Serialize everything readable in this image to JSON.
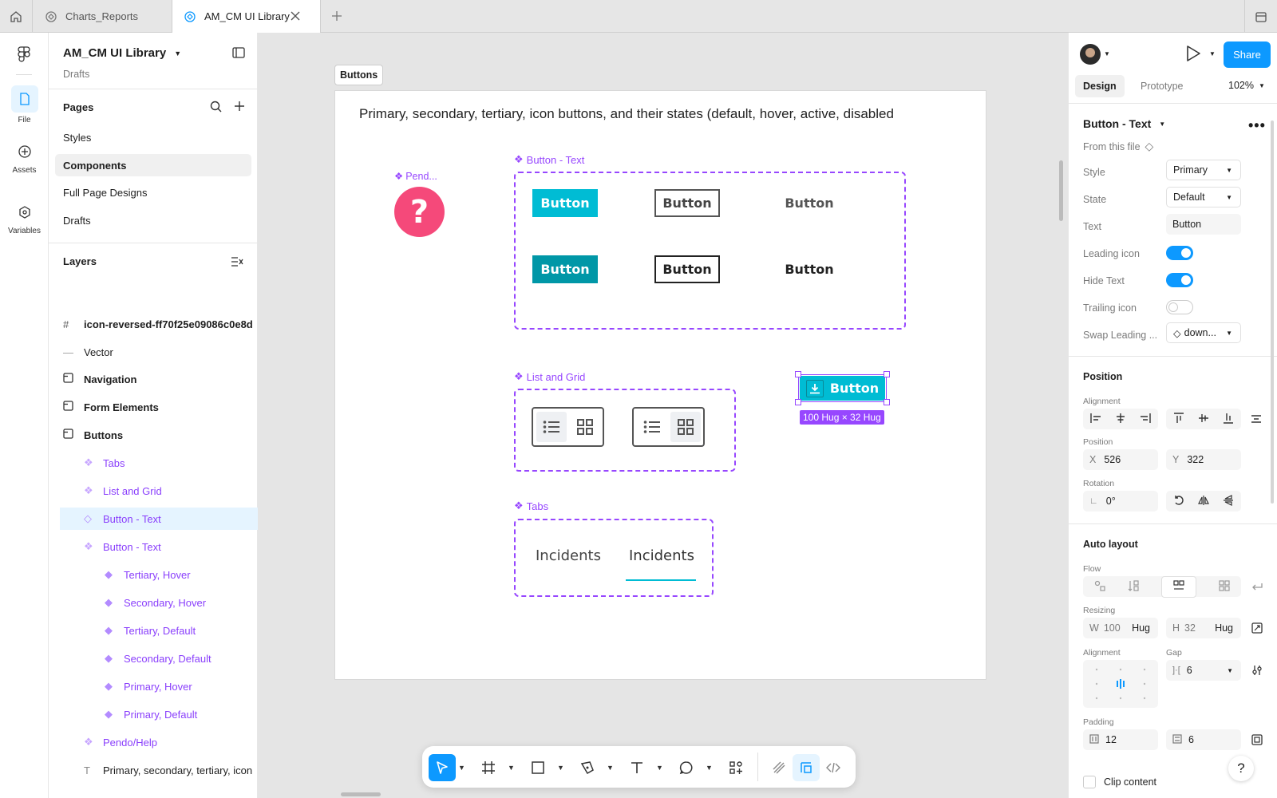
{
  "tabs": [
    {
      "label": "Charts_Reports"
    },
    {
      "label": "AM_CM UI Library"
    }
  ],
  "rail": {
    "file": "File",
    "assets": "Assets",
    "variables": "Variables"
  },
  "file": {
    "title": "AM_CM UI Library",
    "subtitle": "Drafts"
  },
  "pages": {
    "heading": "Pages",
    "items": [
      "Styles",
      "Components",
      "Full Page Designs",
      "Drafts"
    ]
  },
  "layers": {
    "heading": "Layers",
    "items": [
      {
        "label": "icon-reversed-ff70f25e09086c0e8d"
      },
      {
        "label": "Vector"
      },
      {
        "label": "Navigation"
      },
      {
        "label": "Form Elements"
      },
      {
        "label": "Buttons"
      },
      {
        "label": "Tabs"
      },
      {
        "label": "List and Grid"
      },
      {
        "label": "Button - Text"
      },
      {
        "label": "Button - Text"
      },
      {
        "label": "Tertiary, Hover"
      },
      {
        "label": "Secondary, Hover"
      },
      {
        "label": "Tertiary, Default"
      },
      {
        "label": "Secondary, Default"
      },
      {
        "label": "Primary, Hover"
      },
      {
        "label": "Primary, Default"
      },
      {
        "label": "Pendo/Help"
      },
      {
        "label": "Primary, secondary, tertiary, icon"
      }
    ]
  },
  "canvas": {
    "frame_label": "Buttons",
    "description": "Primary, secondary, tertiary, icon buttons, and their states (default, hover, active, disabled",
    "pendo_label": "Pend...",
    "pendo_glyph": "?",
    "button_text_label": "Button - Text",
    "button_label": "Button",
    "list_grid_label": "List and Grid",
    "tabs_label": "Tabs",
    "tab_items": [
      "Incidents",
      "Incidents"
    ],
    "selected_button_label": "Button",
    "size_badge": "100 Hug × 32 Hug"
  },
  "design": {
    "tabs": [
      "Design",
      "Prototype"
    ],
    "zoom": "102%",
    "share": "Share",
    "component_name": "Button - Text",
    "from_file": "From this file",
    "props": {
      "style_label": "Style",
      "style_value": "Primary",
      "state_label": "State",
      "state_value": "Default",
      "text_label": "Text",
      "text_value": "Button",
      "leading_icon_label": "Leading icon",
      "hide_text_label": "Hide Text",
      "trailing_icon_label": "Trailing icon",
      "swap_label": "Swap Leading ...",
      "swap_value": "down..."
    },
    "position": {
      "heading": "Position",
      "alignment": "Alignment",
      "position_label": "Position",
      "x_label": "X",
      "x": "526",
      "y_label": "Y",
      "y": "322",
      "rotation_label": "Rotation",
      "rotation": "0°"
    },
    "auto_layout": {
      "heading": "Auto layout",
      "flow": "Flow",
      "resizing": "Resizing",
      "w_label": "W",
      "w": "100",
      "w_mode": "Hug",
      "h_label": "H",
      "h": "32",
      "h_mode": "Hug",
      "alignment": "Alignment",
      "gap": "Gap",
      "gap_value": "6",
      "padding": "Padding",
      "padding_h": "12",
      "padding_v": "6",
      "clip": "Clip content"
    }
  },
  "toggles": {
    "leading_icon": true,
    "hide_text": true,
    "trailing_icon": false
  },
  "colors": {
    "accent": "#0d99ff",
    "component": "#9747ff",
    "teal": "#00bcd4",
    "teal_dark": "#0097a7",
    "pink": "#f5497a"
  },
  "help_glyph": "?"
}
